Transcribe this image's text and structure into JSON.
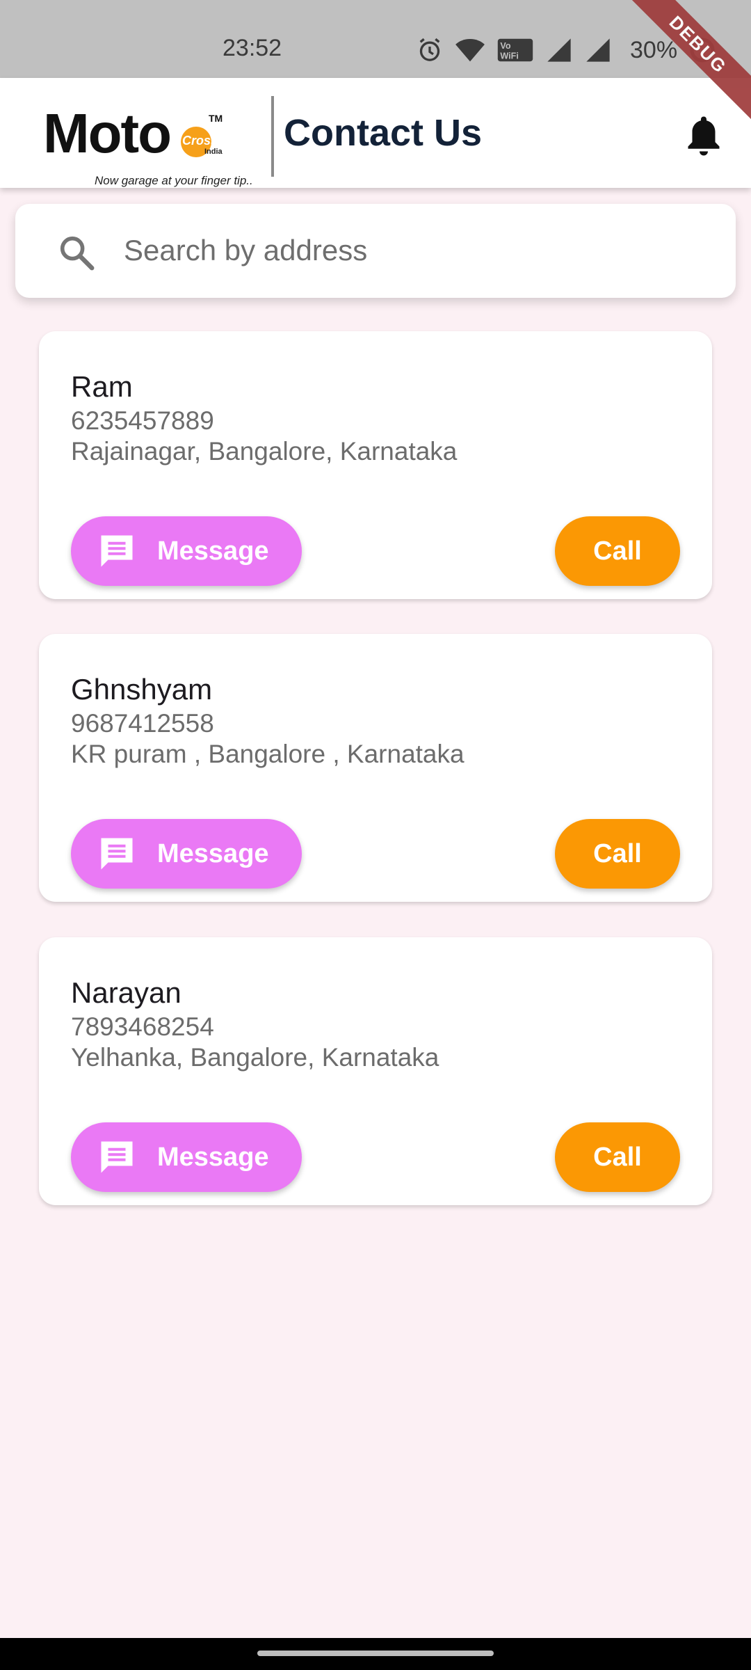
{
  "status_bar": {
    "time": "23:52",
    "battery_text": "30%",
    "icons": [
      "alarm-icon",
      "wifi-icon",
      "vowifi-icon",
      "signal-icon",
      "signal-icon",
      "battery-saver-icon"
    ],
    "debug_banner": "DEBUG"
  },
  "app_bar": {
    "logo": {
      "word": "Moto",
      "badge": "Cross",
      "country": "India",
      "trademark": "TM",
      "tagline": "Now garage at your finger tip.."
    },
    "title": "Contact Us",
    "notification_icon": "bell-icon"
  },
  "search": {
    "placeholder": "Search by address",
    "value": "",
    "icon": "search-icon"
  },
  "contacts": [
    {
      "name": "Ram",
      "phone": "6235457889",
      "address": "Rajainagar, Bangalore, Karnataka",
      "message_label": "Message",
      "call_label": "Call"
    },
    {
      "name": "Ghnshyam",
      "phone": "9687412558",
      "address": "KR puram , Bangalore , Karnataka",
      "message_label": "Message",
      "call_label": "Call"
    },
    {
      "name": "Narayan",
      "phone": "7893468254",
      "address": "Yelhanka, Bangalore, Karnataka",
      "message_label": "Message",
      "call_label": "Call"
    }
  ],
  "colors": {
    "background": "#fcf0f4",
    "message_button": "#ea79f5",
    "call_button": "#fb9804",
    "title": "#132238",
    "logo_accent": "#f6a01a"
  }
}
